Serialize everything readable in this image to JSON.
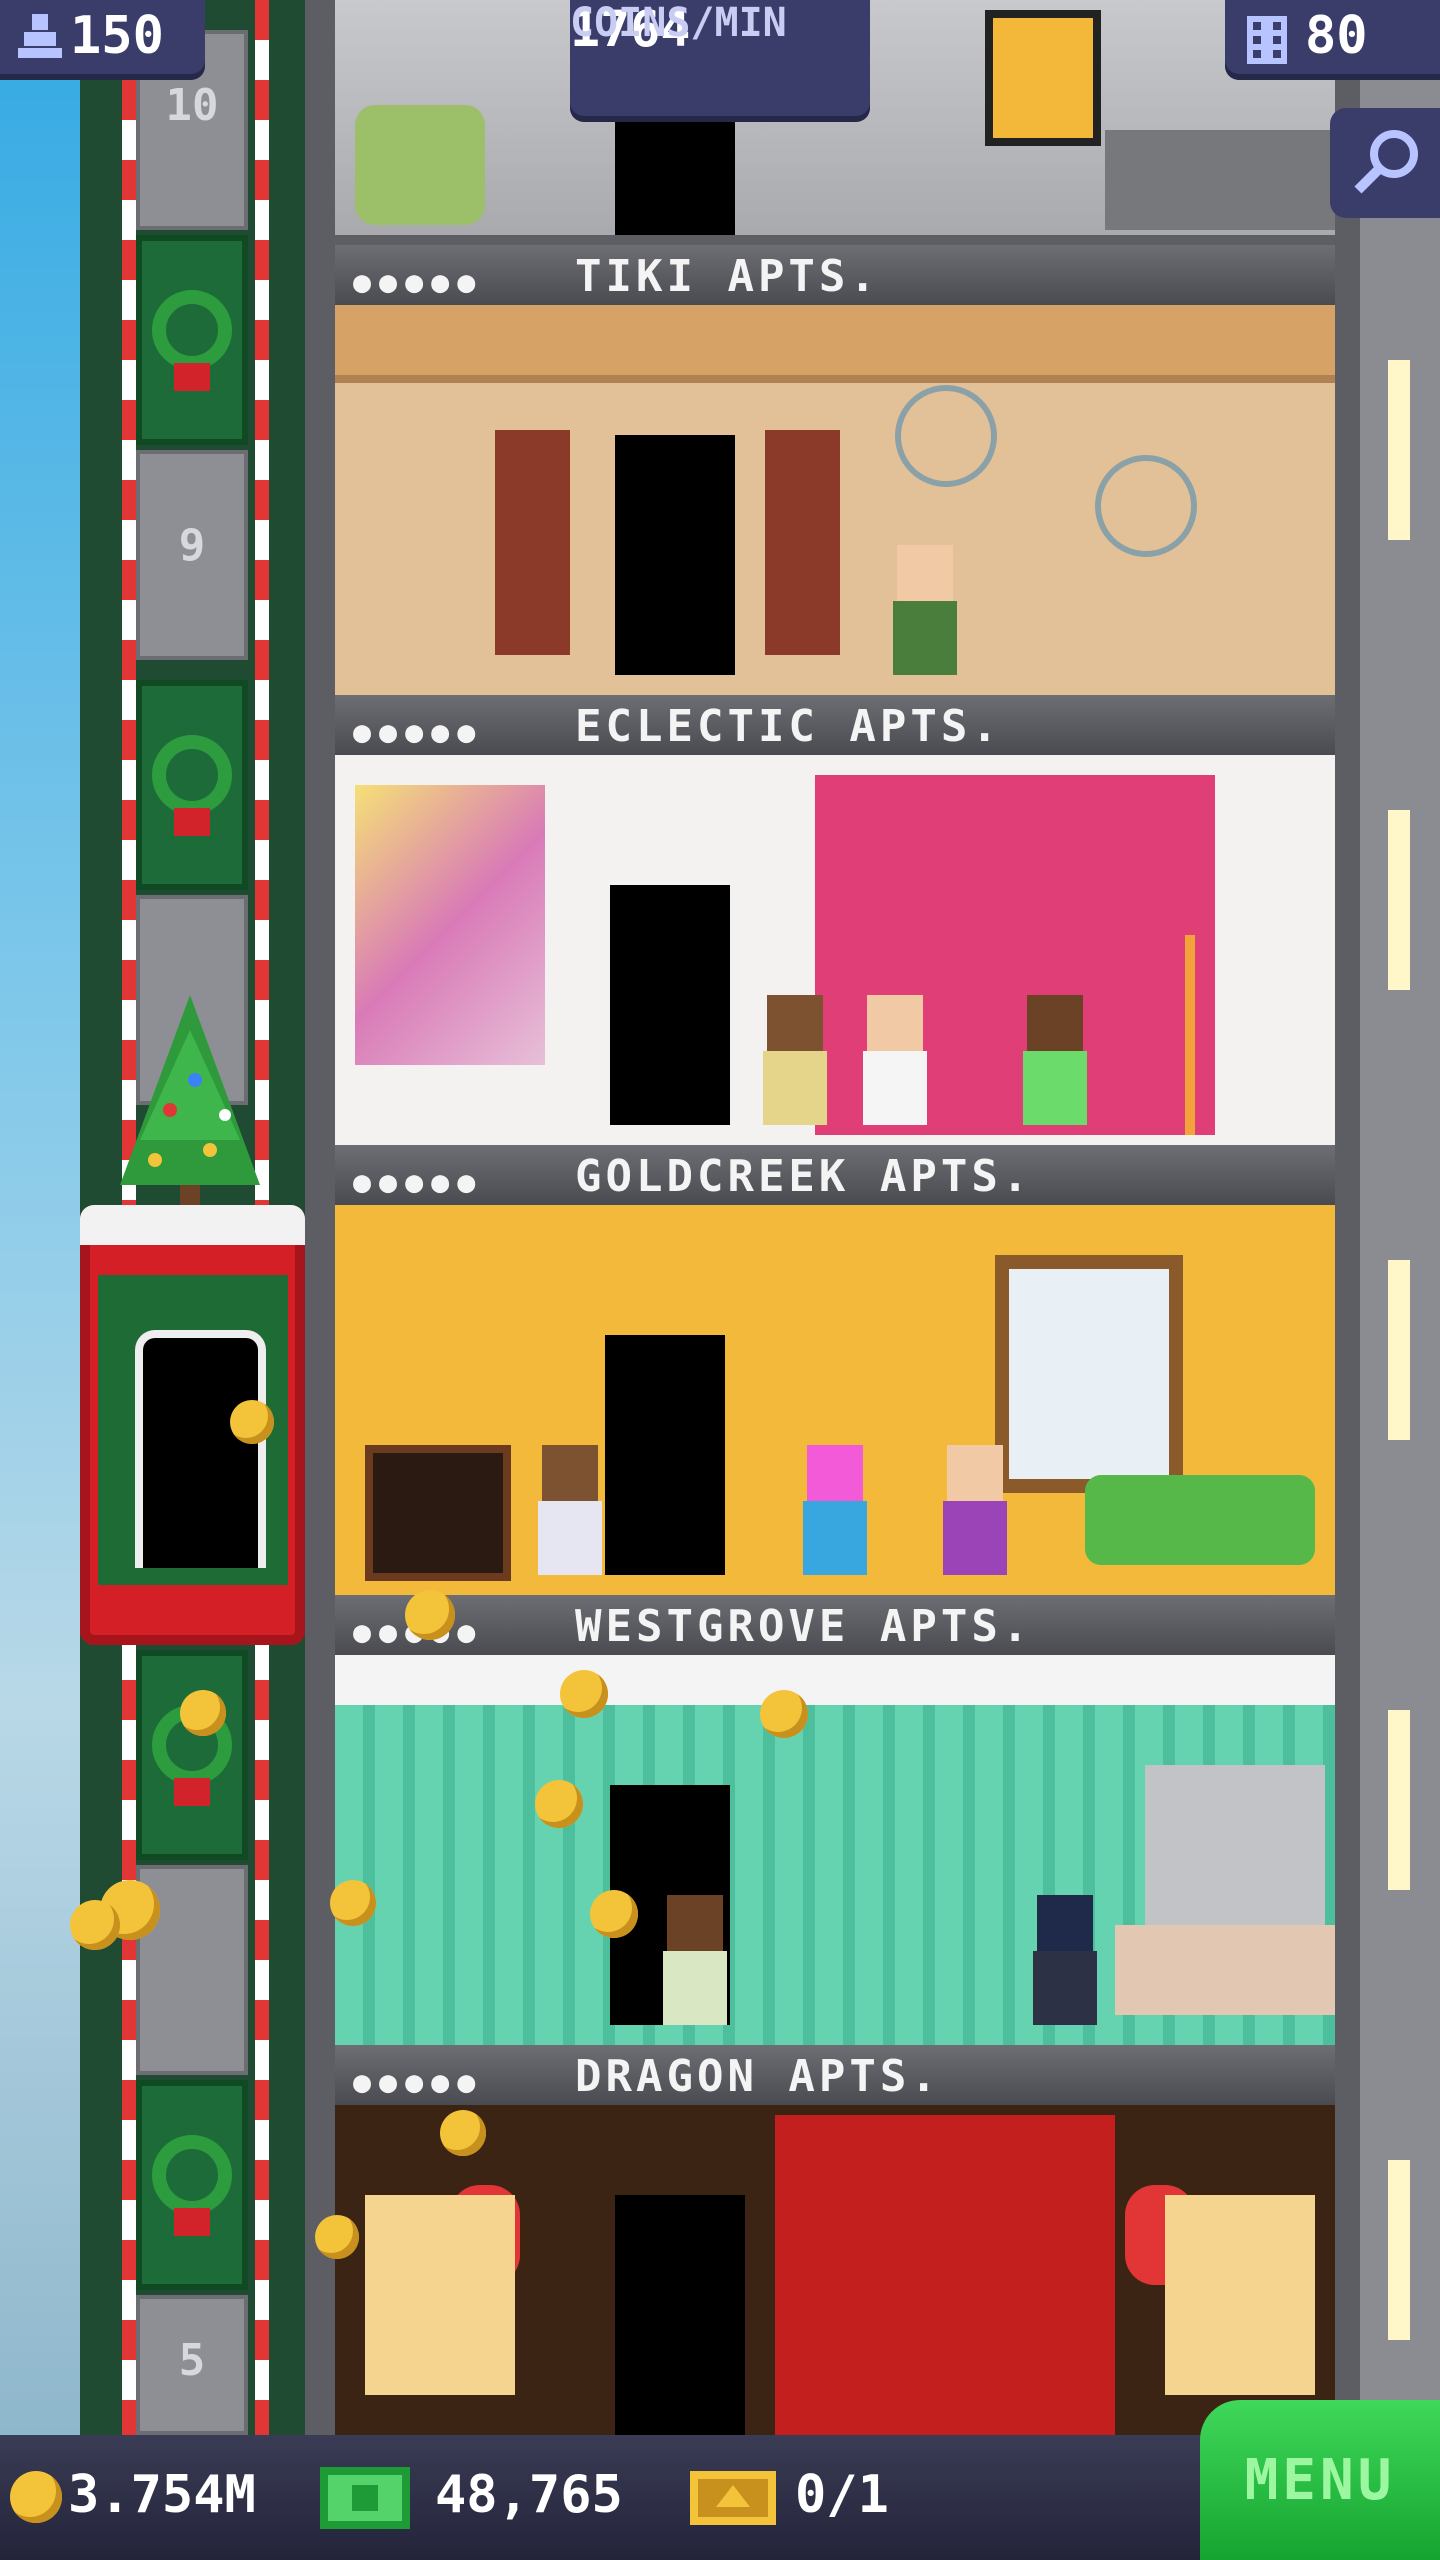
{
  "hud": {
    "population": "150",
    "coins_per_min_value": "1764",
    "coins_per_min_label": "COINS/MIN",
    "floors": "80"
  },
  "elevator": {
    "floor_numbers": [
      "10",
      "9",
      "5"
    ]
  },
  "floors": [
    {
      "name": "TIKI APTS."
    },
    {
      "name": "ECLECTIC APTS."
    },
    {
      "name": "GOLDCREEK APTS."
    },
    {
      "name": "WESTGROVE APTS."
    },
    {
      "name": "DRAGON APTS."
    }
  ],
  "bottom_bar": {
    "coins": "3.754M",
    "bux": "48,765",
    "tickets": "0/1",
    "menu_label": "MENU"
  },
  "icons": {
    "population": "person-icon",
    "floors": "building-icon",
    "search": "magnifier-icon",
    "coins": "coin-icon",
    "bux": "cash-icon",
    "tickets": "ticket-icon"
  },
  "colors": {
    "menu_green": "#16a430",
    "hud_panel": "#3a3c6a",
    "label_text": "#f4f4f4"
  }
}
